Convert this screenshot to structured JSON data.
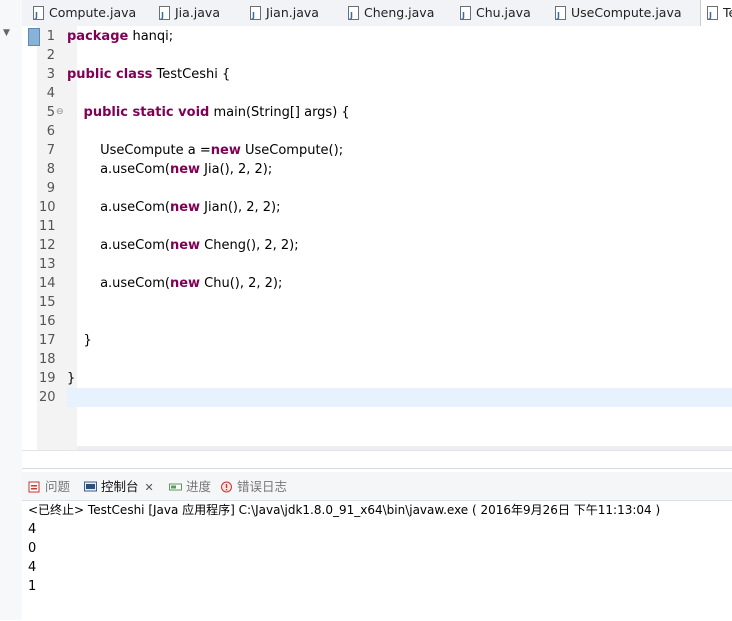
{
  "tabs": [
    {
      "label": "Compute.java"
    },
    {
      "label": "Jia.java"
    },
    {
      "label": "Jian.java"
    },
    {
      "label": "Cheng.java"
    },
    {
      "label": "Chu.java"
    },
    {
      "label": "UseCompute.java"
    },
    {
      "label": "Te"
    }
  ],
  "editor": {
    "lines": [
      {
        "n": "1",
        "kw": "package",
        "rest": " hanqi;"
      },
      {
        "n": "2"
      },
      {
        "n": "3",
        "kw": "public class",
        "rest": " TestCeshi {"
      },
      {
        "n": "4"
      },
      {
        "n": "5",
        "indent": "    ",
        "kw": "public static void",
        "rest": " main(String[] args) {"
      },
      {
        "n": "6"
      },
      {
        "n": "7",
        "indent": "        ",
        "pre": "UseCompute a =",
        "kw": "new",
        "rest": " UseCompute();"
      },
      {
        "n": "8",
        "indent": "        ",
        "pre": "a.useCom(",
        "kw": "new",
        "rest": " Jia(), 2, 2);"
      },
      {
        "n": "9"
      },
      {
        "n": "10",
        "indent": "        ",
        "pre": "a.useCom(",
        "kw": "new",
        "rest": " Jian(), 2, 2);"
      },
      {
        "n": "11"
      },
      {
        "n": "12",
        "indent": "        ",
        "pre": "a.useCom(",
        "kw": "new",
        "rest": " Cheng(), 2, 2);"
      },
      {
        "n": "13"
      },
      {
        "n": "14",
        "indent": "        ",
        "pre": "a.useCom(",
        "kw": "new",
        "rest": " Chu(), 2, 2);"
      },
      {
        "n": "15"
      },
      {
        "n": "16"
      },
      {
        "n": "17",
        "indent": "    ",
        "rest": "}"
      },
      {
        "n": "18"
      },
      {
        "n": "19",
        "rest": "}"
      },
      {
        "n": "20"
      }
    ]
  },
  "panel": {
    "tabs": [
      {
        "label": "问题"
      },
      {
        "label": "控制台"
      },
      {
        "label": "进度"
      },
      {
        "label": "错误日志"
      }
    ],
    "console_header": "<已终止> TestCeshi [Java 应用程序] C:\\Java\\jdk1.8.0_91_x64\\bin\\javaw.exe ( 2016年9月26日 下午11:13:04 )",
    "output": [
      "4",
      "0",
      "4",
      "1"
    ]
  }
}
